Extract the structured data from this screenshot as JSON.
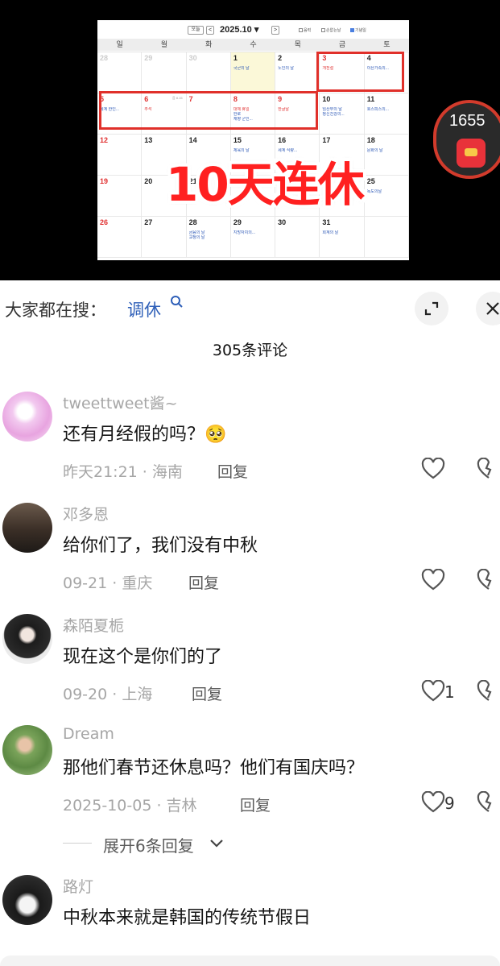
{
  "video": {
    "calendar": {
      "today_btn": "오늘",
      "prev": "<",
      "next": ">",
      "month": "2025.10 ▾",
      "options": [
        "음력",
        "손없는날",
        "기념일"
      ],
      "weekdays": [
        "일",
        "월",
        "화",
        "수",
        "목",
        "금",
        "토"
      ],
      "weeks": [
        [
          {
            "n": "28",
            "gray": true
          },
          {
            "n": "29",
            "gray": true
          },
          {
            "n": "30",
            "gray": true
          },
          {
            "n": "1",
            "ev": "국군의 날",
            "hl": true
          },
          {
            "n": "2",
            "ev": "노인의 날"
          },
          {
            "n": "3",
            "red": true,
            "ev": "개천절",
            "evred": true
          },
          {
            "n": "4",
            "ev": "이산가족의..."
          }
        ],
        [
          {
            "n": "5",
            "red": true,
            "ev": "세계 한인..."
          },
          {
            "n": "6",
            "red": true,
            "ev": "추석",
            "evred": true,
            "sub": "음 8.15"
          },
          {
            "n": "7",
            "red": true
          },
          {
            "n": "8",
            "red": true,
            "ev": "대체 휴일",
            "evred": true,
            "ev2": "한로",
            "ev3": "재향 군인..."
          },
          {
            "n": "9",
            "red": true,
            "ev": "한글날",
            "evred": true
          },
          {
            "n": "10",
            "ev": "임산부의 날",
            "ev2": "정신건강의..."
          },
          {
            "n": "11",
            "ev": "호스피스의..."
          }
        ],
        [
          {
            "n": "12",
            "red": true
          },
          {
            "n": "13"
          },
          {
            "n": "14"
          },
          {
            "n": "15",
            "ev": "체육의 날"
          },
          {
            "n": "16",
            "ev": "세계 식량..."
          },
          {
            "n": "17"
          },
          {
            "n": "18",
            "ev": "문화의 날"
          }
        ],
        [
          {
            "n": "19",
            "red": true
          },
          {
            "n": "20"
          },
          {
            "n": "21"
          },
          {
            "n": "22"
          },
          {
            "n": "23"
          },
          {
            "n": "24"
          },
          {
            "n": "25",
            "ev": "독도의날"
          }
        ],
        [
          {
            "n": "26",
            "red": true
          },
          {
            "n": "27"
          },
          {
            "n": "28",
            "ev": "금융의 날",
            "ev2": "교정의 날"
          },
          {
            "n": "29",
            "ev": "지방자치의..."
          },
          {
            "n": "30"
          },
          {
            "n": "31",
            "ev": "회계의 날"
          },
          {
            "n": ""
          }
        ]
      ]
    },
    "overlay_text": "10天连休",
    "coin_count": "1655"
  },
  "search": {
    "prefix": "大家都在搜：",
    "term": "调休"
  },
  "comments_title": "305条评论",
  "comments": [
    {
      "name": "tweettweet酱~",
      "text": "还有月经假的吗？🥺",
      "date": "昨天21:21",
      "location": "海南",
      "reply": "回复",
      "likes": ""
    },
    {
      "name": "邓多恩",
      "text": "给你们了，我们没有中秋",
      "date": "09-21",
      "location": "重庆",
      "reply": "回复",
      "likes": ""
    },
    {
      "name": "森陌夏栀",
      "text": "现在这个是你们的了",
      "date": "09-20",
      "location": "上海",
      "reply": "回复",
      "likes": "1"
    },
    {
      "name": "Dream",
      "text": "那他们春节还休息吗？他们有国庆吗？",
      "date": "2025-10-05",
      "location": "吉林",
      "reply": "回复",
      "likes": "9"
    },
    {
      "name": "路灯",
      "text": "中秋本来就是韩国的传统节假日",
      "date": "",
      "location": "",
      "reply": "",
      "likes": ""
    }
  ],
  "expand_replies": "展开6条回复",
  "colors": {
    "accent_blue": "#2e5fb8",
    "calendar_red": "#e03030",
    "muted": "#a6a6a6"
  }
}
